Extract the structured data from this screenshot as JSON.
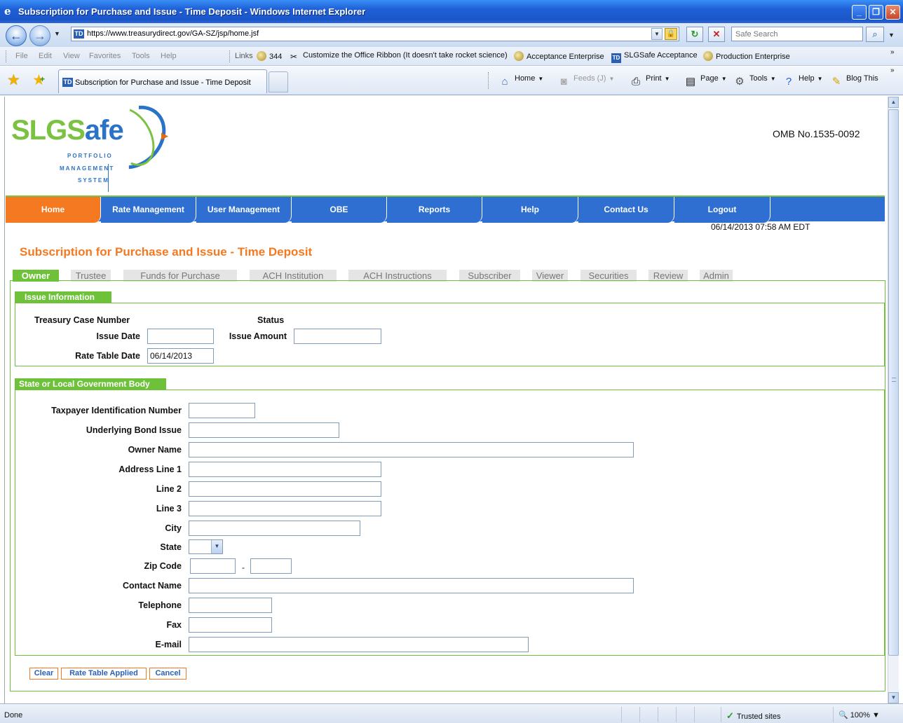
{
  "window": {
    "title": "Subscription for Purchase and Issue - Time Deposit - Windows Internet Explorer"
  },
  "address_bar": {
    "url": "https://www.treasurydirect.gov/GA-SZ/jsp/home.jsf",
    "search_placeholder": "Safe Search"
  },
  "menu": {
    "items": [
      "File",
      "Edit",
      "View",
      "Favorites",
      "Tools",
      "Help"
    ]
  },
  "links_bar": {
    "label": "Links",
    "items": [
      "344",
      "Customize the Office Ribbon (It doesn't take rocket science)",
      "Acceptance Enterprise",
      "SLGSafe Acceptance",
      "Production Enterprise"
    ]
  },
  "browser_tab": {
    "label": "Subscription for Purchase and Issue - Time Deposit"
  },
  "command_bar": {
    "home": "Home",
    "feeds": "Feeds (J)",
    "print": "Print",
    "page": "Page",
    "tools": "Tools",
    "help": "Help",
    "blog": "Blog This"
  },
  "logo": {
    "brand_part1": "SLGS",
    "brand_part2": "afe",
    "line1": "PORTFOLIO",
    "line2": "MANAGEMENT",
    "line3": "SYSTEM"
  },
  "omb": "OMB No.1535-0092",
  "site_nav": {
    "items": [
      "Home",
      "Rate Management",
      "User Management",
      "OBE",
      "Reports",
      "Help",
      "Contact Us",
      "Logout"
    ],
    "active": "Home"
  },
  "datetime": "06/14/2013 07:58 AM EDT",
  "page_title": "Subscription for Purchase and Issue - Time Deposit",
  "sub_tabs": {
    "items": [
      "Owner",
      "Trustee",
      "Funds for Purchase",
      "ACH Institution",
      "ACH Instructions",
      "Subscriber",
      "Viewer",
      "Securities",
      "Review",
      "Admin"
    ],
    "active": "Owner"
  },
  "issue_info": {
    "heading": "Issue Information",
    "treasury_case_label": "Treasury Case Number",
    "status_label": "Status",
    "issue_date_label": "Issue Date",
    "issue_date_value": "",
    "issue_amount_label": "Issue Amount",
    "issue_amount_value": "",
    "rate_table_date_label": "Rate Table Date",
    "rate_table_date_value": "06/14/2013"
  },
  "govt_body": {
    "heading": "State or Local Government Body",
    "tin_label": "Taxpayer Identification Number",
    "bond_issue_label": "Underlying Bond Issue",
    "owner_name_label": "Owner Name",
    "address1_label": "Address Line 1",
    "line2_label": "Line 2",
    "line3_label": "Line 3",
    "city_label": "City",
    "state_label": "State",
    "zip_label": "Zip Code",
    "zip_sep": "-",
    "contact_label": "Contact Name",
    "telephone_label": "Telephone",
    "fax_label": "Fax",
    "email_label": "E-mail"
  },
  "actions": {
    "clear": "Clear",
    "rate_table_applied": "Rate Table Applied",
    "cancel": "Cancel"
  },
  "status_bar": {
    "text": "Done",
    "zone": "Trusted sites",
    "zoom": "100%"
  },
  "colors": {
    "nav_blue": "#2f6fd1",
    "nav_active": "#f47920",
    "section_green": "#6ec23a",
    "title_orange": "#f47920"
  }
}
